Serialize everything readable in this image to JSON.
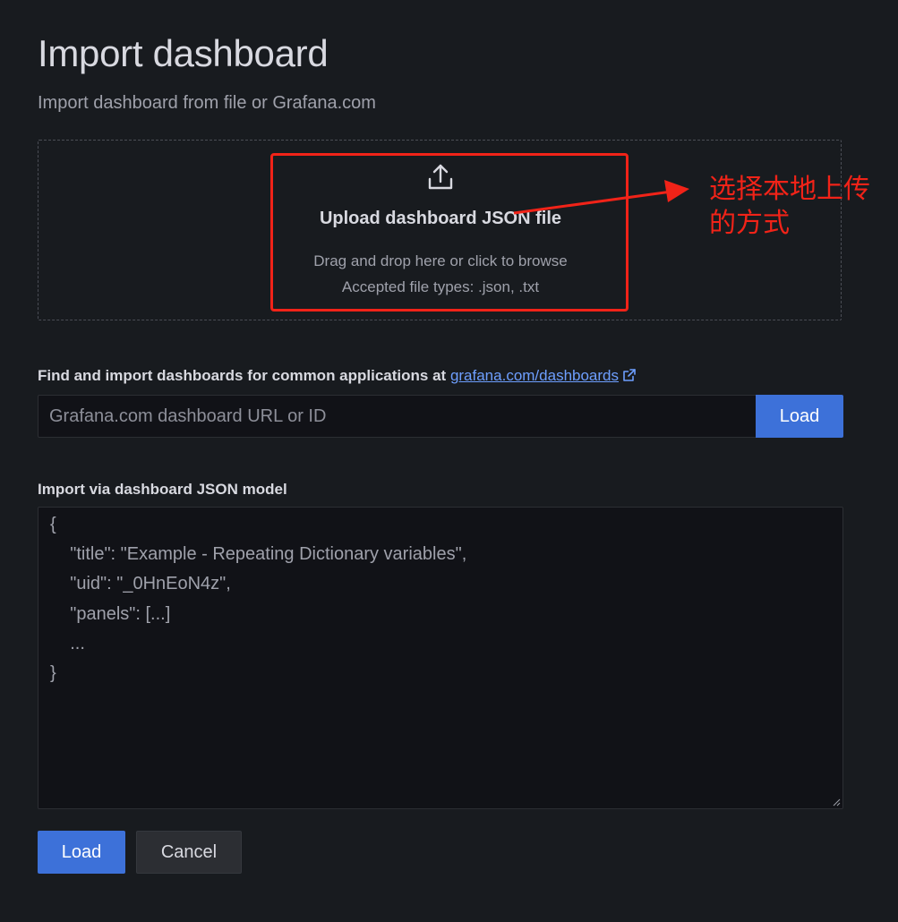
{
  "header": {
    "title": "Import dashboard",
    "subtitle": "Import dashboard from file or Grafana.com"
  },
  "upload": {
    "icon": "upload-icon",
    "title": "Upload dashboard JSON file",
    "hint": "Drag and drop here or click to browse",
    "accepted": "Accepted file types: .json, .txt"
  },
  "annotation": {
    "text": "选择本地上传的方式",
    "color": "#f12318"
  },
  "grafana_com": {
    "label": "Find and import dashboards for common applications at ",
    "link_text": "grafana.com/dashboards",
    "link_icon": "external-link-icon",
    "input_placeholder": "Grafana.com dashboard URL or ID",
    "load_label": "Load"
  },
  "json_model": {
    "label": "Import via dashboard JSON model",
    "lines": [
      "{",
      "    \"title\": \"Example - Repeating Dictionary variables\",",
      "    \"uid\": \"_0HnEoN4z\",",
      "    \"panels\": [...]",
      "    ...",
      "}"
    ]
  },
  "actions": {
    "load_label": "Load",
    "cancel_label": "Cancel"
  },
  "colors": {
    "background": "#181b1f",
    "primary": "#3d71d9",
    "link": "#6e9fff"
  }
}
